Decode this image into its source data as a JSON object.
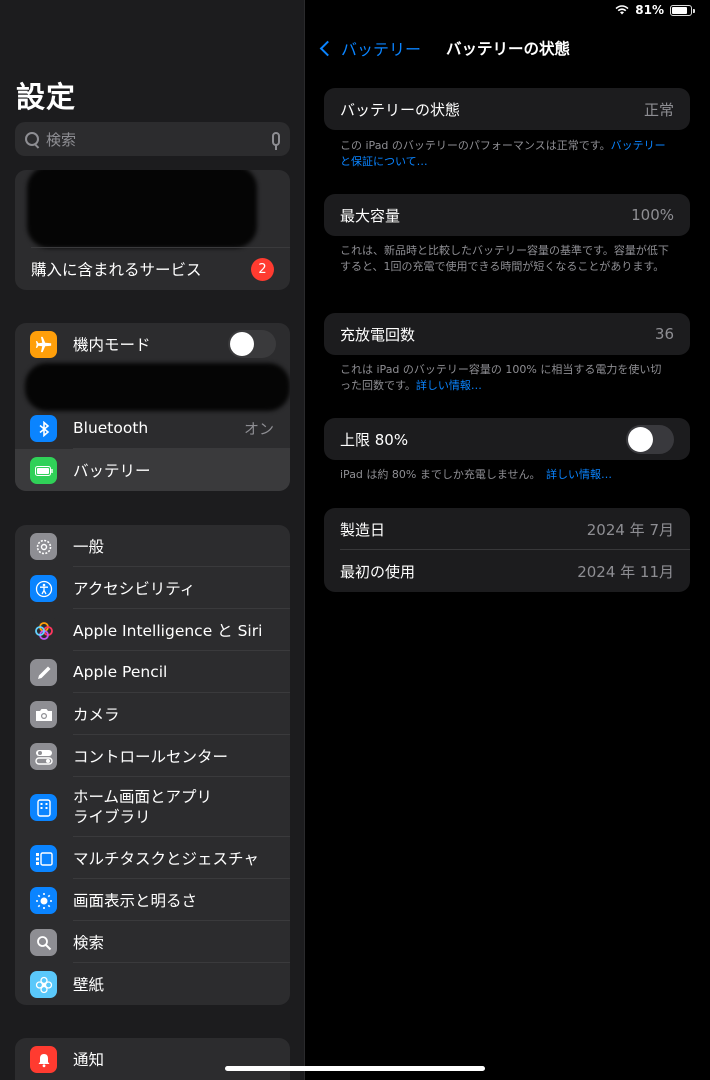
{
  "status_bar": {
    "battery_percent": "81%",
    "battery_level": 0.81
  },
  "sidebar": {
    "title": "設定",
    "search_placeholder": "検索",
    "account": {
      "purchases_label": "購入に含まれるサービス",
      "badge": "2"
    },
    "connectivity": [
      {
        "label": "機内モード",
        "icon": "airplane-icon",
        "color": "#ff9f0a",
        "toggle": false
      },
      {
        "label": "Bluetooth",
        "icon": "bluetooth-icon",
        "color": "#0a84ff",
        "value": "オン"
      },
      {
        "label": "バッテリー",
        "icon": "battery-icon",
        "color": "#30d158",
        "selected": true
      }
    ],
    "general": [
      {
        "label": "一般",
        "icon": "gear-icon",
        "color": "#8e8e93"
      },
      {
        "label": "アクセシビリティ",
        "icon": "accessibility-icon",
        "color": "#0a84ff"
      },
      {
        "label": "Apple Intelligence と Siri",
        "icon": "siri-icon",
        "color": "#2c2c2e"
      },
      {
        "label": "Apple Pencil",
        "icon": "pencil-icon",
        "color": "#8e8e93"
      },
      {
        "label": "カメラ",
        "icon": "camera-icon",
        "color": "#8e8e93"
      },
      {
        "label": "コントロールセンター",
        "icon": "control-center-icon",
        "color": "#8e8e93"
      },
      {
        "label_line1": "ホーム画面とアプリ",
        "label_line2": "ライブラリ",
        "icon": "home-screen-icon",
        "color": "#0a84ff"
      },
      {
        "label": "マルチタスクとジェスチャ",
        "icon": "multitasking-icon",
        "color": "#0a84ff"
      },
      {
        "label": "画面表示と明るさ",
        "icon": "brightness-icon",
        "color": "#0a84ff"
      },
      {
        "label": "検索",
        "icon": "search-icon",
        "color": "#8e8e93"
      },
      {
        "label": "壁紙",
        "icon": "wallpaper-icon",
        "color": "#5ac8fa"
      }
    ],
    "notifications": [
      {
        "label": "通知",
        "icon": "notification-icon",
        "color": "#ff3b30"
      }
    ]
  },
  "main": {
    "back_label": "バッテリー",
    "title": "バッテリーの状態",
    "health": {
      "label": "バッテリーの状態",
      "value": "正常",
      "note": "この iPad のバッテリーのパフォーマンスは正常です。",
      "note_link": "バッテリーと保証について…"
    },
    "max_capacity": {
      "label": "最大容量",
      "value": "100%",
      "note": "これは、新品時と比較したバッテリー容量の基準です。容量が低下すると、1回の充電で使用できる時間が短くなることがあります。"
    },
    "cycle_count": {
      "label": "充放電回数",
      "value": "36",
      "note": "これは iPad のバッテリー容量の 100% に相当する電力を使い切った回数です。",
      "note_link": "詳しい情報…"
    },
    "limit": {
      "label": "上限 80%",
      "toggle": false,
      "note": "iPad は約 80% までしか充電しません。",
      "note_link": "詳しい情報…"
    },
    "dates": {
      "manufactured_label": "製造日",
      "manufactured_value": "2024 年 7月",
      "first_use_label": "最初の使用",
      "first_use_value": "2024 年 11月"
    }
  }
}
